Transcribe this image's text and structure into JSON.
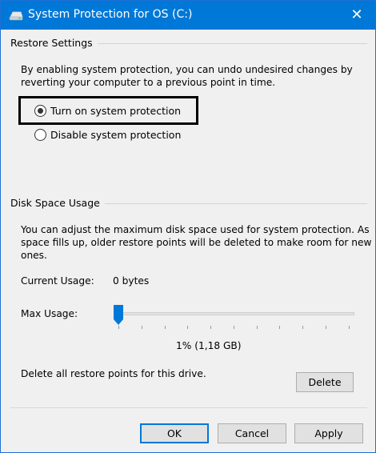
{
  "window": {
    "title": "System Protection for OS (C:)",
    "icon": "drive-icon",
    "accent_color": "#0078d7"
  },
  "restore_settings": {
    "heading": "Restore Settings",
    "description_line1": "By enabling system protection, you can undo undesired changes by",
    "description_line2": "reverting your computer to a previous point in time.",
    "options": [
      {
        "label": "Turn on system protection",
        "checked": true
      },
      {
        "label": "Disable system protection",
        "checked": false
      }
    ]
  },
  "disk_space": {
    "heading": "Disk Space Usage",
    "description_line1": "You can adjust the maximum disk space used for system protection. As",
    "description_line2": "space fills up, older restore points will be deleted to make room for new",
    "description_line3": "ones.",
    "current_usage_label": "Current Usage:",
    "current_usage_value": "0 bytes",
    "max_usage_label": "Max Usage:",
    "max_usage_value": "1% (1,18 GB)",
    "max_usage_fraction": 0.01,
    "delete_text": "Delete all restore points for this drive.",
    "delete_label": "Delete"
  },
  "footer": {
    "ok_label": "OK",
    "cancel_label": "Cancel",
    "apply_label": "Apply"
  }
}
